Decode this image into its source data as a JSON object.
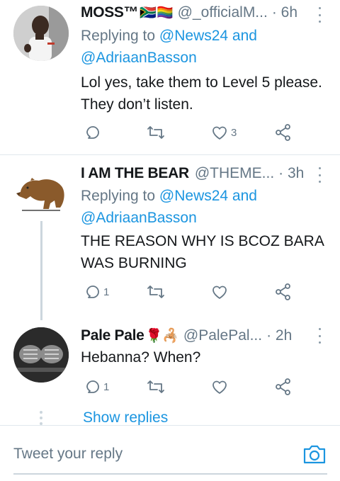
{
  "tweets": [
    {
      "name": "MOSS™",
      "name_emoji": "🇿🇦🏳️‍🌈",
      "handle": "@_officialM...",
      "time": "· 6h",
      "replying_prefix": "Replying to ",
      "mention_1": "@News24",
      "and_text": " and",
      "mention_2": "@AdriaanBasson",
      "text_line_1": "Lol yes, take them to Level 5 please.",
      "text_line_2": "They don’t listen.",
      "reply_count": "",
      "retweet_count": "",
      "like_count": "3",
      "avatar_icon": "person-photo-avatar"
    },
    {
      "name": "I AM THE BEAR",
      "name_emoji": "",
      "handle": "@THEME...",
      "time": "· 3h",
      "replying_prefix": "Replying to ",
      "mention_1": "@News24",
      "and_text": " and",
      "mention_2": "@AdriaanBasson",
      "text_line_1": "THE REASON WHY IS BCOZ BARA",
      "text_line_2": "WAS BURNING",
      "reply_count": "1",
      "retweet_count": "",
      "like_count": "",
      "avatar_icon": "bear-avatar"
    },
    {
      "name": "Pale Pale",
      "name_emoji": "🌹🦂",
      "handle": "@PalePal...",
      "time": "· 2h",
      "text_line_1": "Hebanna? When?",
      "reply_count": "1",
      "retweet_count": "",
      "like_count": "",
      "avatar_icon": "fists-photo-avatar"
    }
  ],
  "show_replies": "Show replies",
  "composer": {
    "placeholder": "Tweet your reply",
    "camera_icon": "camera-icon"
  },
  "colors": {
    "accent": "#1b95e0",
    "secondary_text": "#657786",
    "divider": "#e1e8ed"
  }
}
